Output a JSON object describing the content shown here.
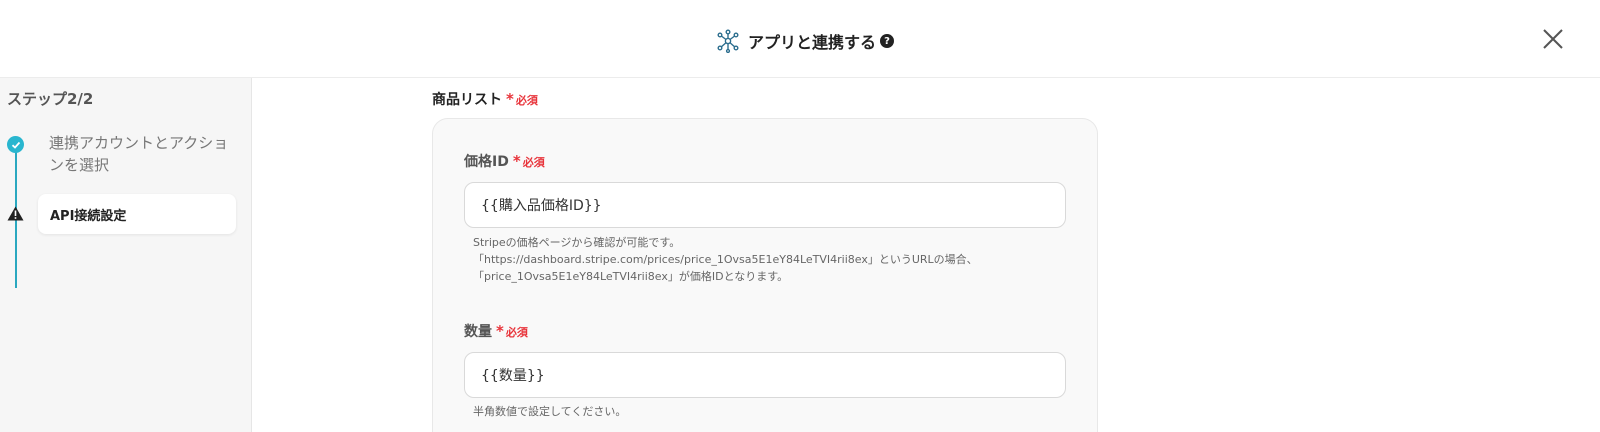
{
  "header": {
    "title": "アプリと連携する",
    "help_icon": "?",
    "app_icon": "network-nodes-icon",
    "close_icon": "close-icon"
  },
  "sidebar": {
    "step_heading": "ステップ2/2",
    "steps": [
      {
        "label": "連携アカウントとアクションを選択",
        "status": "done",
        "icon": "check-circle-icon"
      },
      {
        "label": "API接続設定",
        "status": "warning",
        "icon": "warning-triangle-icon"
      }
    ]
  },
  "form": {
    "section_label": "商品リスト",
    "required_star": "*",
    "required_text": "必須",
    "fields": [
      {
        "label": "価格ID",
        "value": "{{購入品価格ID}}",
        "help": [
          "Stripeの価格ページから確認が可能です。",
          "「https://dashboard.stripe.com/prices/price_1Ovsa5E1eY84LeTVI4rii8ex」というURLの場合、",
          "「price_1Ovsa5E1eY84LeTVI4rii8ex」が価格IDとなります。"
        ]
      },
      {
        "label": "数量",
        "value": "{{数量}}",
        "help": [
          "半角数値で設定してください。"
        ]
      }
    ]
  },
  "colors": {
    "accent": "#29b6cf",
    "required": "#e8333a",
    "sidebar_bg": "#f6f6f6",
    "panel_bg": "#f9f9f9"
  }
}
